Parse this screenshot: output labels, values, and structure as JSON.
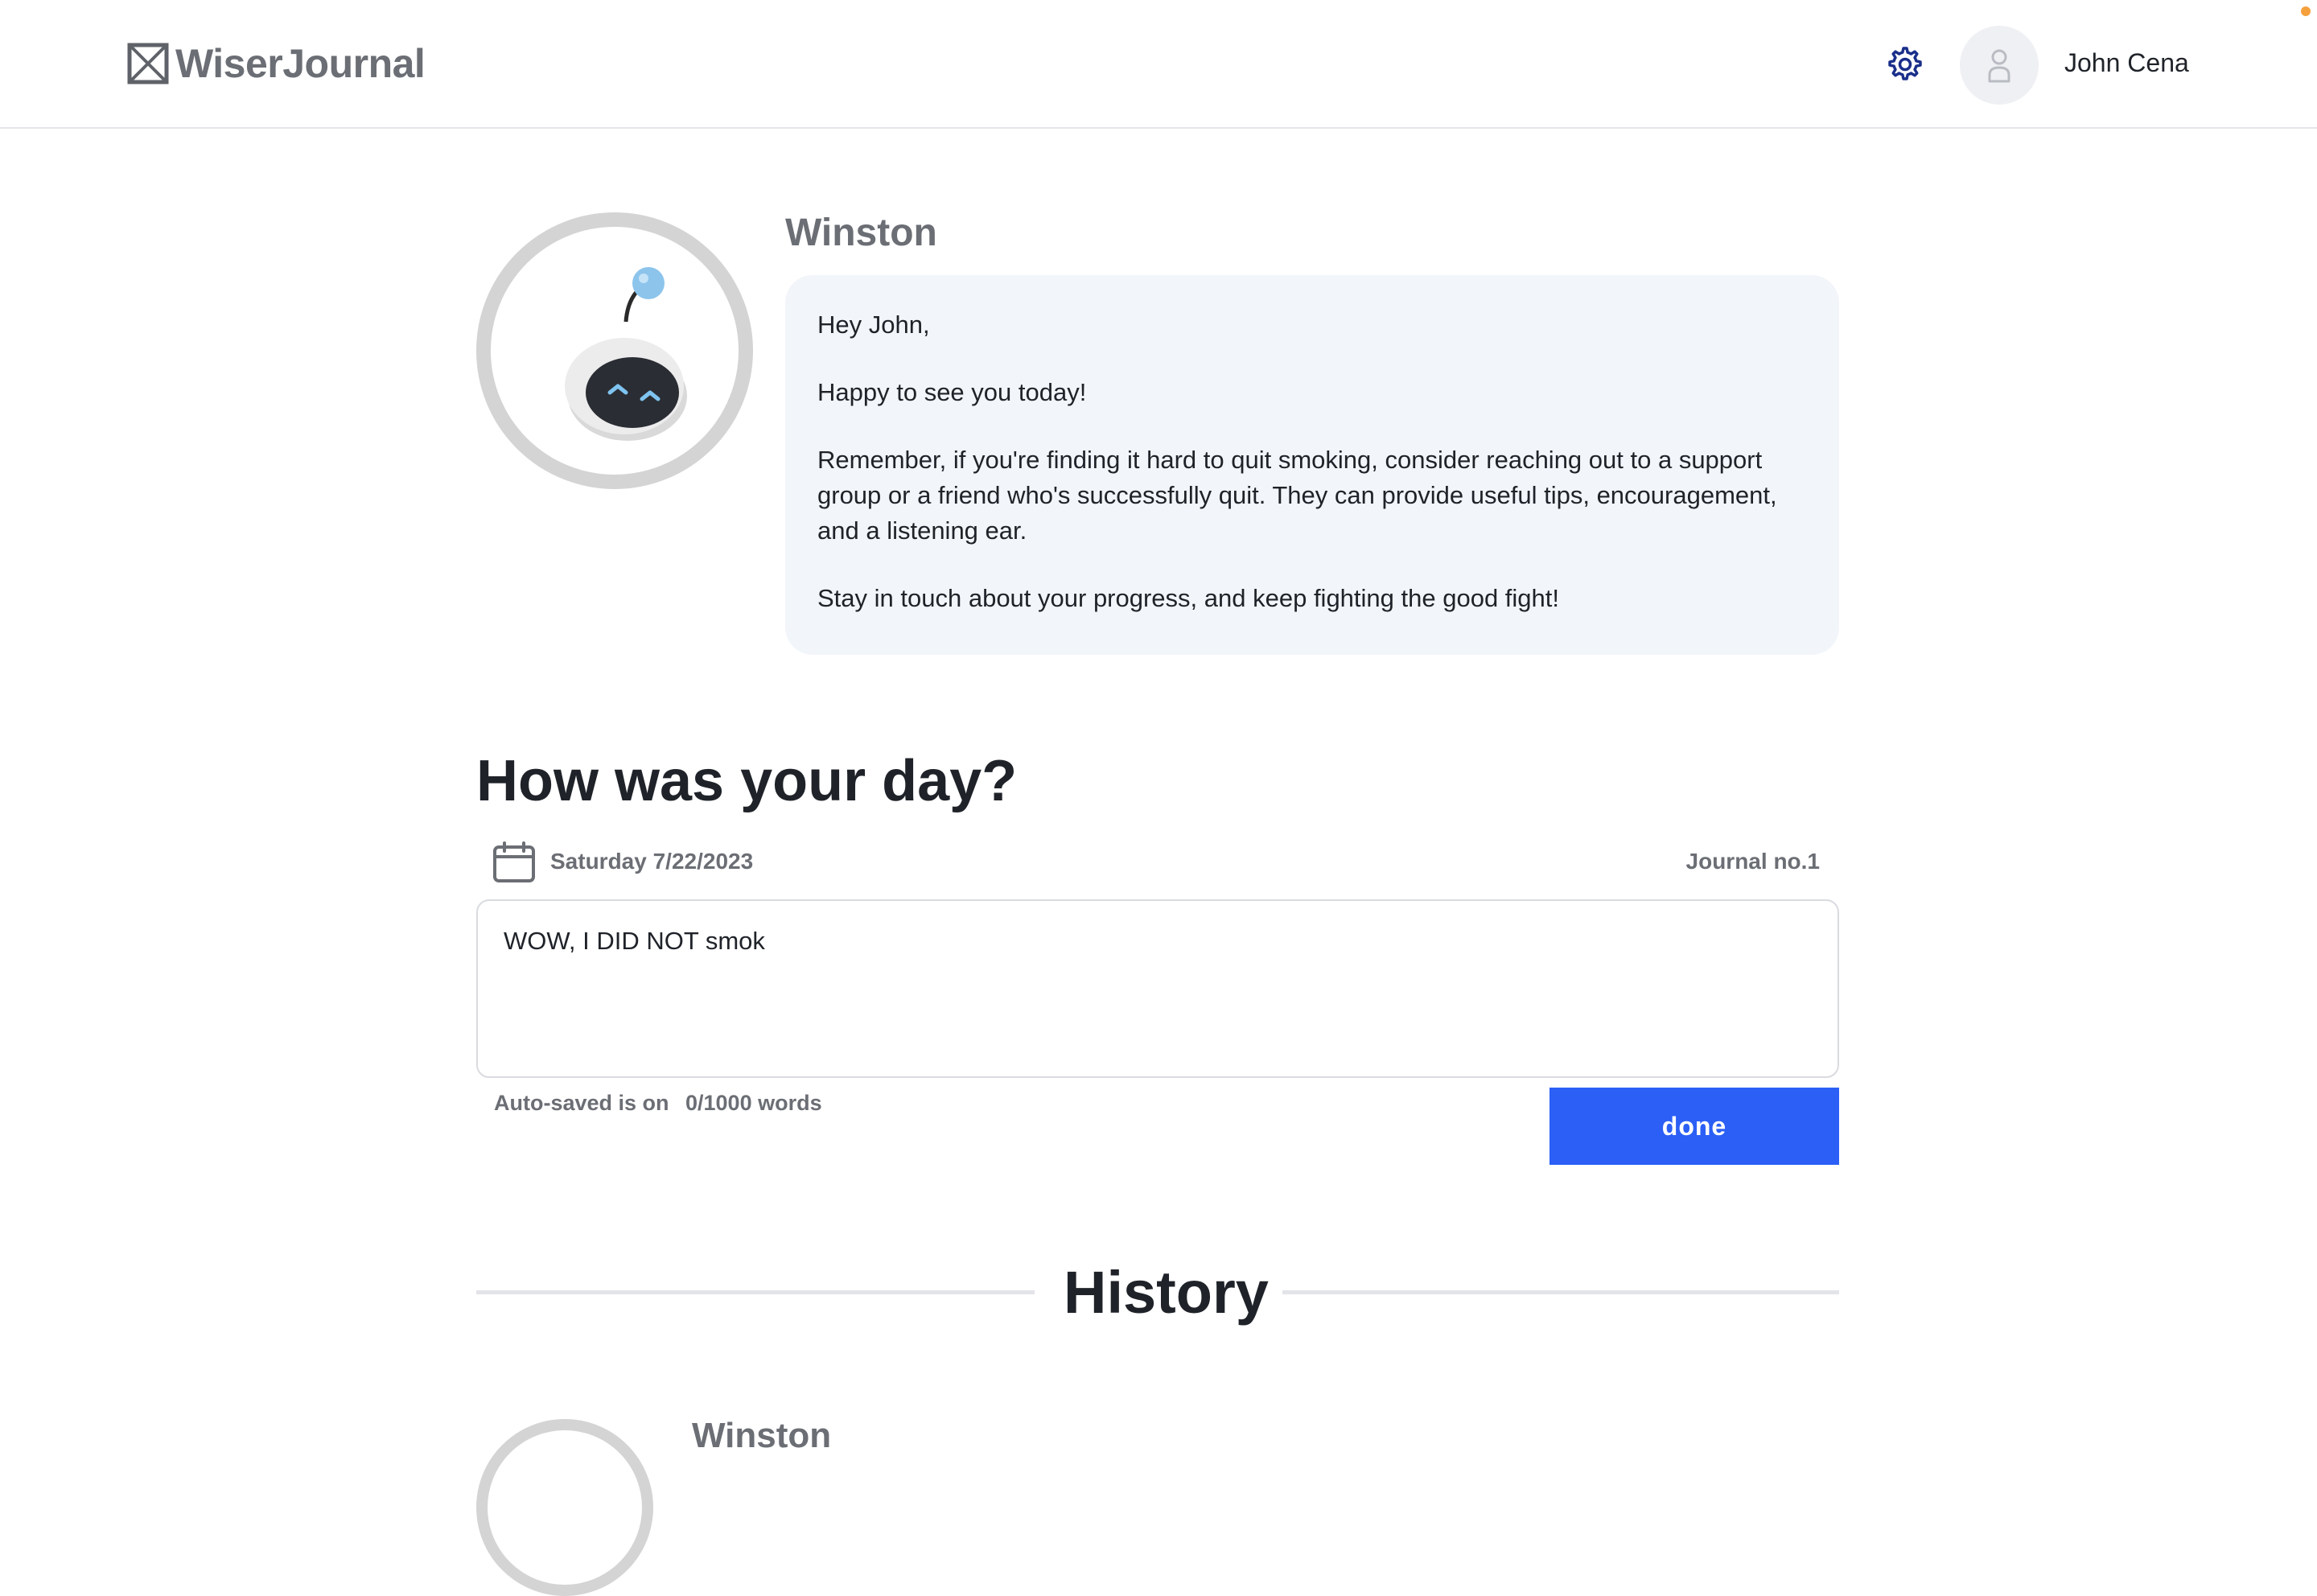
{
  "header": {
    "logo_text": "WiserJournal",
    "user_name": "John Cena",
    "settings_icon": "gear-icon",
    "avatar_icon": "user-icon"
  },
  "bot": {
    "name": "Winston",
    "avatar_icon": "robot-icon",
    "message": [
      "Hey John,",
      "Happy to see you today!",
      "Remember, if you're finding it hard to quit smoking, consider reaching out to a support group or a friend who's successfully quit. They can provide useful tips, encouragement, and a listening ear.",
      "Stay in touch about your progress, and keep fighting the good fight!"
    ]
  },
  "journal": {
    "title": "How was your day?",
    "date": "Saturday 7/22/2023",
    "date_icon": "calendar-icon",
    "journal_number": "Journal no.1",
    "entry_text": "WOW, I DID NOT smok",
    "autosave_status": "Auto-saved is on",
    "word_count": "0/1000 words",
    "done_label": "done"
  },
  "history": {
    "title": "History",
    "first_entry_name": "Winston"
  },
  "colors": {
    "accent": "#2b5ff6",
    "bubble_bg": "#f2f5f9",
    "muted_text": "#6b6e74",
    "notification_dot": "#f5a03c"
  }
}
